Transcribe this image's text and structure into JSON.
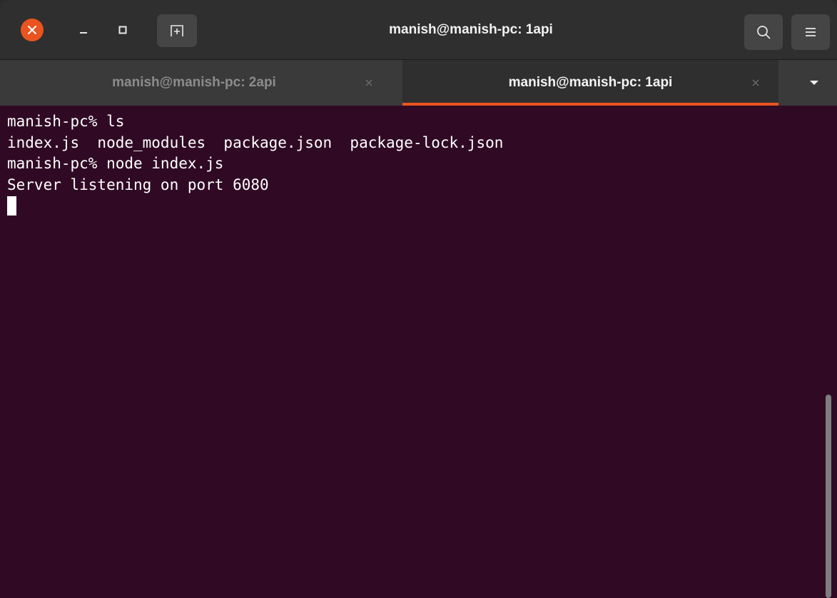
{
  "window": {
    "title": "manish@manish-pc: 1api"
  },
  "colors": {
    "accent": "#e95420",
    "terminal_background": "#300a24",
    "headerbar": "#2f2f2f",
    "tabbar": "#3a3a3a"
  },
  "icons": {
    "close": "close-icon",
    "minimize": "minimize-icon",
    "maximize": "maximize-icon",
    "new_tab": "new-tab-icon",
    "search": "search-icon",
    "menu": "hamburger-menu-icon",
    "tab_close": "close-icon",
    "dropdown": "chevron-down-icon"
  },
  "tabs": [
    {
      "label": "manish@manish-pc: 2api",
      "active": false
    },
    {
      "label": "manish@manish-pc: 1api",
      "active": true
    }
  ],
  "terminal": {
    "lines": [
      "manish-pc% ls",
      "index.js  node_modules  package.json  package-lock.json",
      "manish-pc% node index.js",
      "Server listening on port 6080"
    ]
  }
}
